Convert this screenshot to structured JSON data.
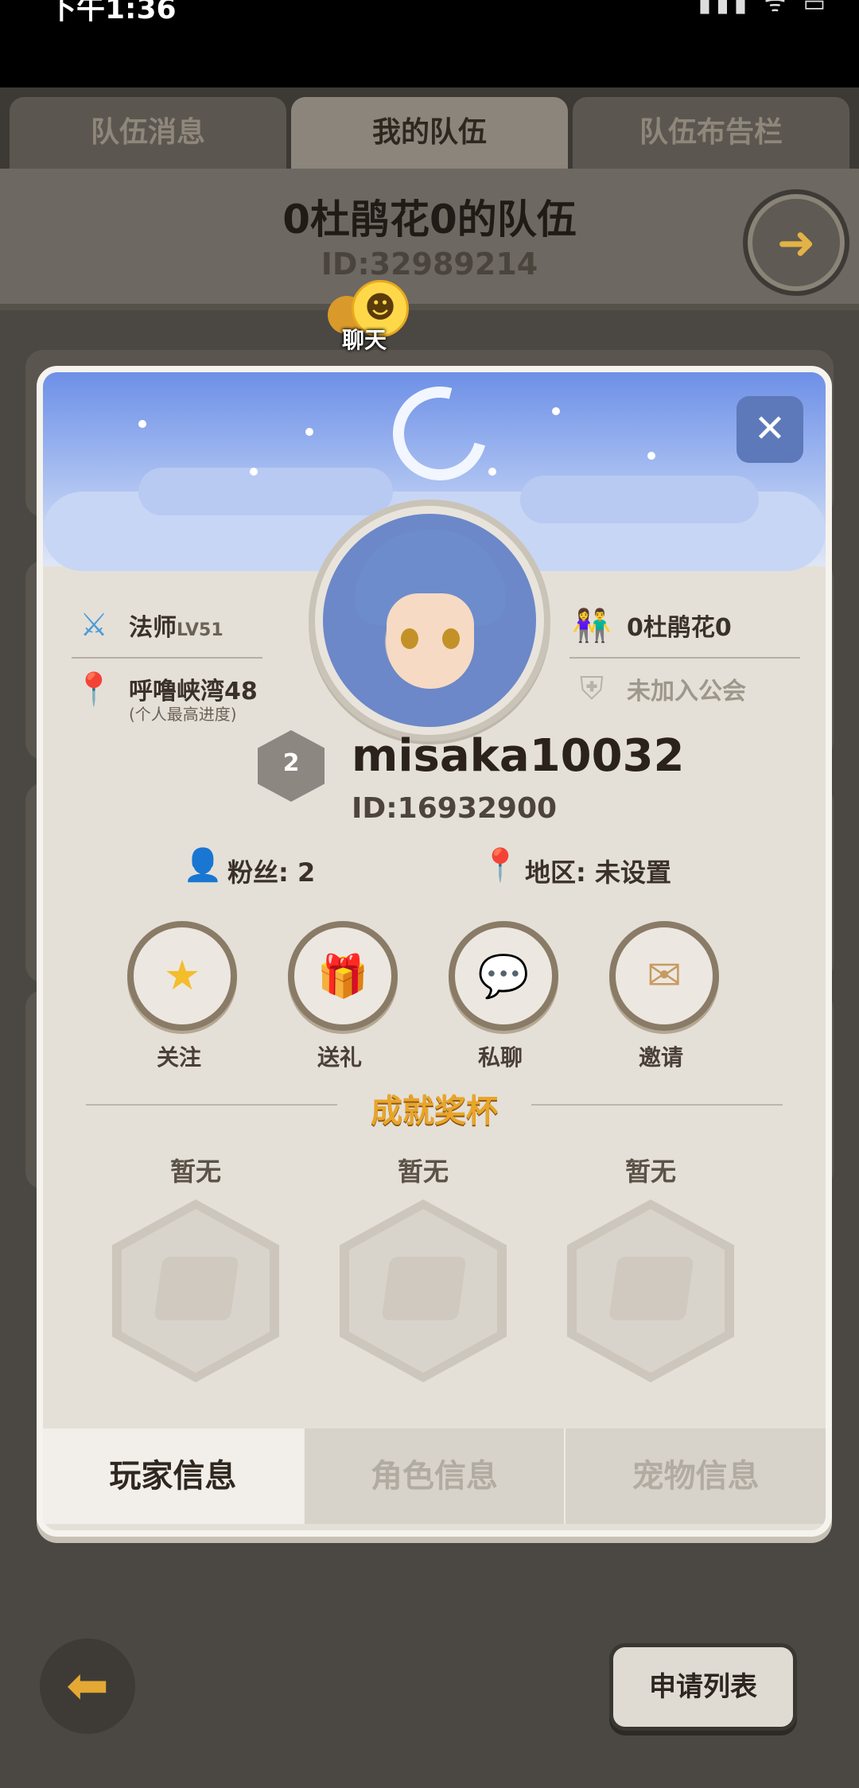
{
  "status_bar": {
    "time": "下午1:36",
    "icons": "▮▮▮ ᯤ ▭"
  },
  "top_tabs": [
    {
      "label": "队伍消息",
      "active": false
    },
    {
      "label": "我的队伍",
      "active": true
    },
    {
      "label": "队伍布告栏",
      "active": false
    }
  ],
  "team": {
    "title": "0杜鹃花0的队伍",
    "id": "ID:32989214"
  },
  "chat": {
    "label": "聊天"
  },
  "profile": {
    "class_name": "法师",
    "level": "LV51",
    "location": "呼噜峡湾48",
    "location_note": "(个人最高进度)",
    "partner": "0杜鹃花0",
    "guild": "未加入公会",
    "rank": "2",
    "username": "misaka10032",
    "user_id": "ID:16932900",
    "fans": "粉丝: 2",
    "region": "地区: 未设置"
  },
  "actions": [
    {
      "label": "关注",
      "icon": "star-icon",
      "glyph": "★"
    },
    {
      "label": "送礼",
      "icon": "gift-icon",
      "glyph": "🎁"
    },
    {
      "label": "私聊",
      "icon": "chat-icon",
      "glyph": "💬"
    },
    {
      "label": "邀请",
      "icon": "envelope-icon",
      "glyph": "✉"
    }
  ],
  "achievements": {
    "title": "成就奖杯",
    "slots": [
      {
        "label": "暂无"
      },
      {
        "label": "暂无"
      },
      {
        "label": "暂无"
      }
    ]
  },
  "bottom_tabs": [
    {
      "label": "玩家信息",
      "active": true
    },
    {
      "label": "角色信息",
      "active": false
    },
    {
      "label": "宠物信息",
      "active": false
    }
  ],
  "footer": {
    "apply_list": "申请列表"
  },
  "colors": {
    "accent": "#e9a52a",
    "background": "#4b4843",
    "card": "#e4e0d8"
  }
}
